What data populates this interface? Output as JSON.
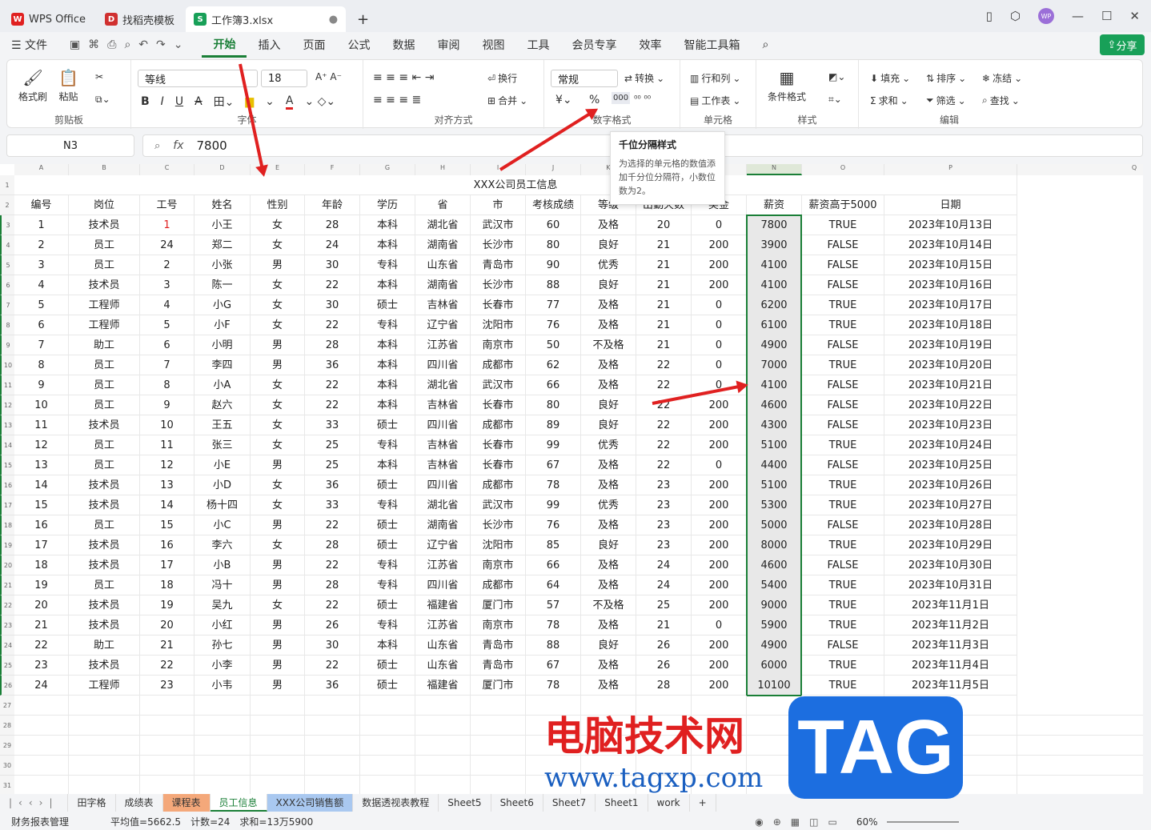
{
  "tabs": [
    {
      "label": "WPS Office",
      "icon": "wps-icon",
      "color": "#e02020"
    },
    {
      "label": "找稻壳模板",
      "icon": "docer-icon",
      "color": "#d03030"
    },
    {
      "label": "工作簿3.xlsx",
      "icon": "sheet-icon",
      "color": "#18a058"
    }
  ],
  "user_badge": "WP",
  "menu": {
    "file": "文件",
    "items": [
      "开始",
      "插入",
      "页面",
      "公式",
      "数据",
      "审阅",
      "视图",
      "工具",
      "会员专享",
      "效率",
      "智能工具箱"
    ],
    "active": "开始",
    "share": "分享"
  },
  "ribbon": {
    "clipboard": {
      "label": "剪贴板",
      "format_painter": "格式刷",
      "paste": "粘贴"
    },
    "font": {
      "label": "字体",
      "font_name": "等线",
      "font_size": "18"
    },
    "alignment": {
      "label": "对齐方式",
      "wrap": "换行",
      "merge": "合并"
    },
    "number": {
      "label": "数字格式",
      "format": "常规",
      "convert": "转换",
      "percent": "%",
      "thousands": "000"
    },
    "cells": {
      "label": "单元格",
      "row_col": "行和列",
      "worksheet": "工作表"
    },
    "styles": {
      "label": "样式",
      "cond_format": "条件格式"
    },
    "edit": {
      "label": "编辑",
      "fill": "填充",
      "sort": "排序",
      "freeze": "冻结",
      "sum": "求和",
      "filter": "筛选",
      "find": "查找"
    }
  },
  "formula": {
    "cell": "N3",
    "value": "7800"
  },
  "tooltip": {
    "title": "千位分隔样式",
    "body": "为选择的单元格的数值添加千分位分隔符，小数位数为2。"
  },
  "columns": [
    "A",
    "B",
    "C",
    "D",
    "E",
    "F",
    "G",
    "H",
    "I",
    "J",
    "K",
    "L",
    "M",
    "N",
    "O",
    "P",
    "Q"
  ],
  "sheet_title": "XXX公司员工信息",
  "headers": [
    "编号",
    "岗位",
    "工号",
    "姓名",
    "性别",
    "年龄",
    "学历",
    "省",
    "市",
    "考核成绩",
    "等级",
    "出勤天数",
    "奖金",
    "薪资",
    "薪资高于5000",
    "日期"
  ],
  "rows": [
    [
      "1",
      "技术员",
      "1",
      "小王",
      "女",
      "28",
      "本科",
      "湖北省",
      "武汉市",
      "60",
      "及格",
      "20",
      "0",
      "7800",
      "TRUE",
      "2023年10月13日"
    ],
    [
      "2",
      "员工",
      "24",
      "郑二",
      "女",
      "24",
      "本科",
      "湖南省",
      "长沙市",
      "80",
      "良好",
      "21",
      "200",
      "3900",
      "FALSE",
      "2023年10月14日"
    ],
    [
      "3",
      "员工",
      "2",
      "小张",
      "男",
      "30",
      "专科",
      "山东省",
      "青岛市",
      "90",
      "优秀",
      "21",
      "200",
      "4100",
      "FALSE",
      "2023年10月15日"
    ],
    [
      "4",
      "技术员",
      "3",
      "陈一",
      "女",
      "22",
      "本科",
      "湖南省",
      "长沙市",
      "88",
      "良好",
      "21",
      "200",
      "4100",
      "FALSE",
      "2023年10月16日"
    ],
    [
      "5",
      "工程师",
      "4",
      "小G",
      "女",
      "30",
      "硕士",
      "吉林省",
      "长春市",
      "77",
      "及格",
      "21",
      "0",
      "6200",
      "TRUE",
      "2023年10月17日"
    ],
    [
      "6",
      "工程师",
      "5",
      "小F",
      "女",
      "22",
      "专科",
      "辽宁省",
      "沈阳市",
      "76",
      "及格",
      "21",
      "0",
      "6100",
      "TRUE",
      "2023年10月18日"
    ],
    [
      "7",
      "助工",
      "6",
      "小明",
      "男",
      "28",
      "本科",
      "江苏省",
      "南京市",
      "50",
      "不及格",
      "21",
      "0",
      "4900",
      "FALSE",
      "2023年10月19日"
    ],
    [
      "8",
      "员工",
      "7",
      "李四",
      "男",
      "36",
      "本科",
      "四川省",
      "成都市",
      "62",
      "及格",
      "22",
      "0",
      "7000",
      "TRUE",
      "2023年10月20日"
    ],
    [
      "9",
      "员工",
      "8",
      "小A",
      "女",
      "22",
      "本科",
      "湖北省",
      "武汉市",
      "66",
      "及格",
      "22",
      "0",
      "4100",
      "FALSE",
      "2023年10月21日"
    ],
    [
      "10",
      "员工",
      "9",
      "赵六",
      "女",
      "22",
      "本科",
      "吉林省",
      "长春市",
      "80",
      "良好",
      "22",
      "200",
      "4600",
      "FALSE",
      "2023年10月22日"
    ],
    [
      "11",
      "技术员",
      "10",
      "王五",
      "女",
      "33",
      "硕士",
      "四川省",
      "成都市",
      "89",
      "良好",
      "22",
      "200",
      "4300",
      "FALSE",
      "2023年10月23日"
    ],
    [
      "12",
      "员工",
      "11",
      "张三",
      "女",
      "25",
      "专科",
      "吉林省",
      "长春市",
      "99",
      "优秀",
      "22",
      "200",
      "5100",
      "TRUE",
      "2023年10月24日"
    ],
    [
      "13",
      "员工",
      "12",
      "小E",
      "男",
      "25",
      "本科",
      "吉林省",
      "长春市",
      "67",
      "及格",
      "22",
      "0",
      "4400",
      "FALSE",
      "2023年10月25日"
    ],
    [
      "14",
      "技术员",
      "13",
      "小D",
      "女",
      "36",
      "硕士",
      "四川省",
      "成都市",
      "78",
      "及格",
      "23",
      "200",
      "5100",
      "TRUE",
      "2023年10月26日"
    ],
    [
      "15",
      "技术员",
      "14",
      "杨十四",
      "女",
      "33",
      "专科",
      "湖北省",
      "武汉市",
      "99",
      "优秀",
      "23",
      "200",
      "5300",
      "TRUE",
      "2023年10月27日"
    ],
    [
      "16",
      "员工",
      "15",
      "小C",
      "男",
      "22",
      "硕士",
      "湖南省",
      "长沙市",
      "76",
      "及格",
      "23",
      "200",
      "5000",
      "FALSE",
      "2023年10月28日"
    ],
    [
      "17",
      "技术员",
      "16",
      "李六",
      "女",
      "28",
      "硕士",
      "辽宁省",
      "沈阳市",
      "85",
      "良好",
      "23",
      "200",
      "8000",
      "TRUE",
      "2023年10月29日"
    ],
    [
      "18",
      "技术员",
      "17",
      "小B",
      "男",
      "22",
      "专科",
      "江苏省",
      "南京市",
      "66",
      "及格",
      "24",
      "200",
      "4600",
      "FALSE",
      "2023年10月30日"
    ],
    [
      "19",
      "员工",
      "18",
      "冯十",
      "男",
      "28",
      "专科",
      "四川省",
      "成都市",
      "64",
      "及格",
      "24",
      "200",
      "5400",
      "TRUE",
      "2023年10月31日"
    ],
    [
      "20",
      "技术员",
      "19",
      "吴九",
      "女",
      "22",
      "硕士",
      "福建省",
      "厦门市",
      "57",
      "不及格",
      "25",
      "200",
      "9000",
      "TRUE",
      "2023年11月1日"
    ],
    [
      "21",
      "技术员",
      "20",
      "小红",
      "男",
      "26",
      "专科",
      "江苏省",
      "南京市",
      "78",
      "及格",
      "21",
      "0",
      "5900",
      "TRUE",
      "2023年11月2日"
    ],
    [
      "22",
      "助工",
      "21",
      "孙七",
      "男",
      "30",
      "本科",
      "山东省",
      "青岛市",
      "88",
      "良好",
      "26",
      "200",
      "4900",
      "FALSE",
      "2023年11月3日"
    ],
    [
      "23",
      "技术员",
      "22",
      "小李",
      "男",
      "22",
      "硕士",
      "山东省",
      "青岛市",
      "67",
      "及格",
      "26",
      "200",
      "6000",
      "TRUE",
      "2023年11月4日"
    ],
    [
      "24",
      "工程师",
      "23",
      "小韦",
      "男",
      "36",
      "硕士",
      "福建省",
      "厦门市",
      "78",
      "及格",
      "28",
      "200",
      "10100",
      "TRUE",
      "2023年11月5日"
    ]
  ],
  "sheet_tabs": [
    "田字格",
    "成绩表",
    "课程表",
    "员工信息",
    "XXX公司销售额",
    "数据透视表教程",
    "Sheet5",
    "Sheet6",
    "Sheet7",
    "Sheet1",
    "work"
  ],
  "active_sheet": "员工信息",
  "status": {
    "workbook": "财务报表管理",
    "avg": "平均值=5662.5",
    "count": "计数=24",
    "sum": "求和=13万5900",
    "zoom": "60%"
  },
  "watermark": {
    "cn": "电脑技术网",
    "url": "www.tagxp.com",
    "tag": "TAG"
  }
}
